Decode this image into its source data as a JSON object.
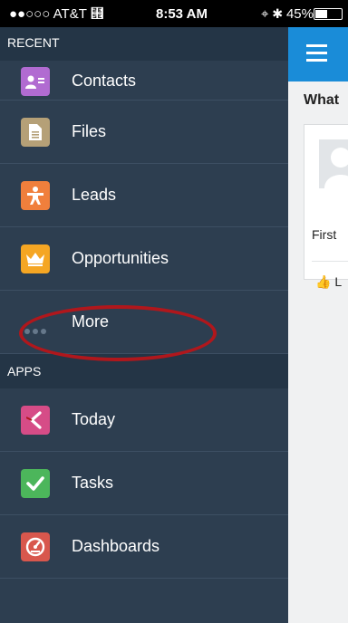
{
  "status_bar": {
    "carrier": "●●○○○ AT&T",
    "wifi_icon": "wifi-icon",
    "time": "8:53 AM",
    "right_text": "⌖ ✱ 45%",
    "battery_level": 0.45
  },
  "sidebar": {
    "recent_header": "RECENT",
    "recent_items": [
      {
        "label": "Contacts",
        "icon": "contacts-icon",
        "color": "#b16bd1"
      },
      {
        "label": "Files",
        "icon": "files-icon",
        "color": "#b5a077"
      },
      {
        "label": "Leads",
        "icon": "leads-icon",
        "color": "#f07f3c"
      },
      {
        "label": "Opportunities",
        "icon": "opportunities-icon",
        "color": "#f5a623"
      },
      {
        "label": "More",
        "icon": "more-icon"
      }
    ],
    "apps_header": "APPS",
    "app_items": [
      {
        "label": "Today",
        "icon": "today-icon",
        "color": "#d64c87"
      },
      {
        "label": "Tasks",
        "icon": "tasks-icon",
        "color": "#4cb65b"
      },
      {
        "label": "Dashboards",
        "icon": "dashboards-icon",
        "color": "#d8574d"
      }
    ]
  },
  "content": {
    "header_color": "#1a8cd8",
    "menu_icon": "hamburger-icon",
    "heading": "What",
    "card_text": "First",
    "like_text": "L"
  }
}
